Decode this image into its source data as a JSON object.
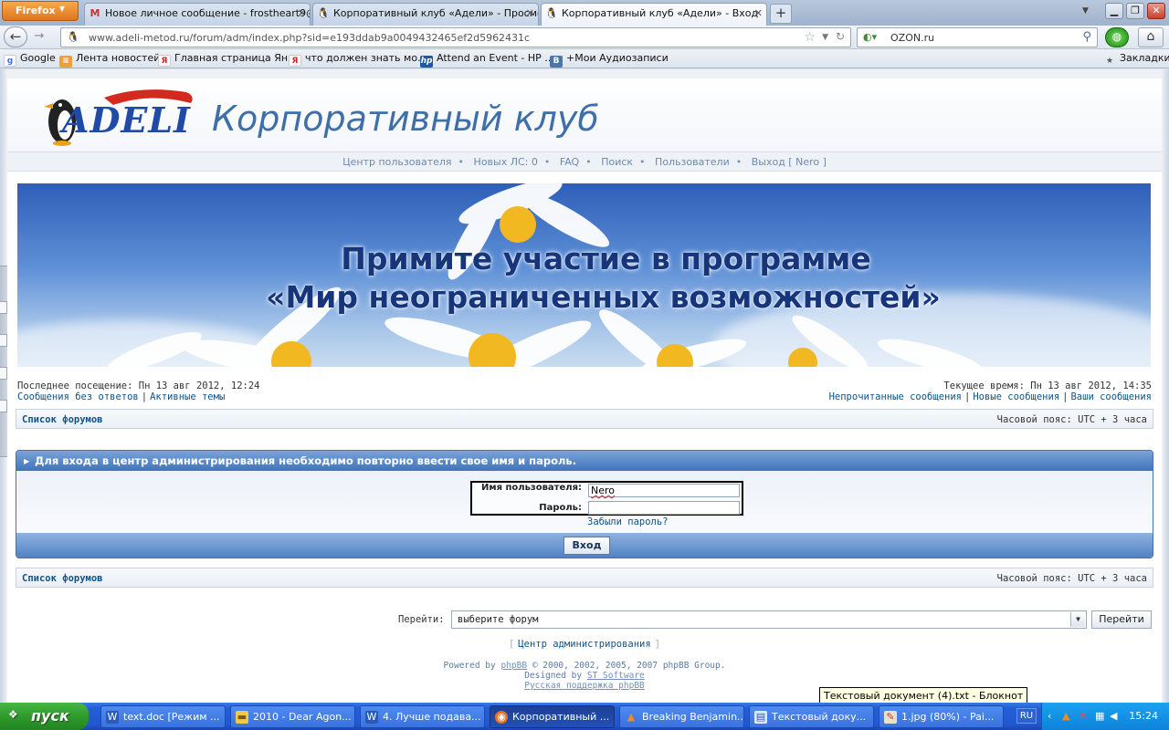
{
  "browser": {
    "menu_label": "Firefox",
    "tabs": [
      {
        "title": "Новое личное сообщение - frostheart9@...",
        "icon": "gmail-icon"
      },
      {
        "title": "Корпоративный клуб «Адели» - Просмо...",
        "icon": "adeli-penguin-icon"
      },
      {
        "title": "Корпоративный клуб «Адели» - Вход",
        "icon": "adeli-penguin-icon"
      }
    ],
    "url": "www.adeli-metod.ru/forum/adm/index.php?sid=e193ddab9a0049432465ef2d5962431c",
    "search_value": "OZON.ru",
    "bookmarks": [
      {
        "label": "Google"
      },
      {
        "label": "Лента новостей"
      },
      {
        "label": "Главная страница Ян..."
      },
      {
        "label": "что должен знать мо..."
      },
      {
        "label": "Attend an Event - HP ..."
      },
      {
        "label": "+Мои Аудиозаписи"
      }
    ],
    "bookmarks_menu": "Закладки"
  },
  "site": {
    "logo_text": "ADELI",
    "title": "Корпоративный клуб",
    "topnav": [
      {
        "label": "Центр пользователя"
      },
      {
        "label": "Новых ЛС: 0"
      },
      {
        "label": "FAQ"
      },
      {
        "label": "Поиск"
      },
      {
        "label": "Пользователи"
      },
      {
        "label": "Выход [ Nero ]"
      }
    ],
    "banner": {
      "line1": "Примите участие в программе",
      "line2": "«Мир неограниченных возможностей»"
    },
    "last_visit": "Последнее посещение: Пн 13 авг 2012, 12:24",
    "current_time": "Текущее время: Пн 13 авг 2012, 14:35",
    "left_links": [
      "Сообщения без ответов",
      "Активные темы"
    ],
    "right_links": [
      "Непрочитанные сообщения",
      "Новые сообщения",
      "Ваши сообщения"
    ],
    "forum_index": "Список форумов",
    "timezone": "Часовой пояс: UTC + 3 часа",
    "login": {
      "header": "Для входа в центр администрирования необходимо повторно ввести свое имя и пароль.",
      "username_label": "Имя пользователя:",
      "username_value": "Nero",
      "password_label": "Пароль:",
      "password_value": "",
      "forgot": "Забыли пароль?",
      "submit": "Вход"
    },
    "jump": {
      "label": "Перейти:",
      "selected": "выберите форум",
      "button": "Перейти"
    },
    "admin_link": "Центр администрирования",
    "footer": {
      "powered_by_prefix": "Powered by",
      "powered_by_link": "phpBB",
      "powered_by_suffix": "© 2000, 2002, 2005, 2007 phpBB Group.",
      "designed_by_prefix": "Designed by",
      "designed_by_link": "ST Software",
      "support_link": "Русская поддержка phpBB"
    }
  },
  "taskbar": {
    "start_label": "пуск",
    "items": [
      {
        "label": "text.doc [Режим ...",
        "icon": "word-icon"
      },
      {
        "label": "2010 - Dear Agon...",
        "icon": "folder-icon"
      },
      {
        "label": "4. Лучше подава...",
        "icon": "word-icon"
      },
      {
        "label": "Корпоративный ...",
        "icon": "firefox-icon"
      },
      {
        "label": "Breaking Benjamin...",
        "icon": "vlc-icon"
      },
      {
        "label": "Текстовый доку...",
        "icon": "notepad-icon"
      },
      {
        "label": "1.jpg (80%) - Pai...",
        "icon": "paint-icon"
      }
    ],
    "language": "RU",
    "clock": "15:24",
    "tooltip": "Текстовый документ (4).txt - Блокнот"
  }
}
